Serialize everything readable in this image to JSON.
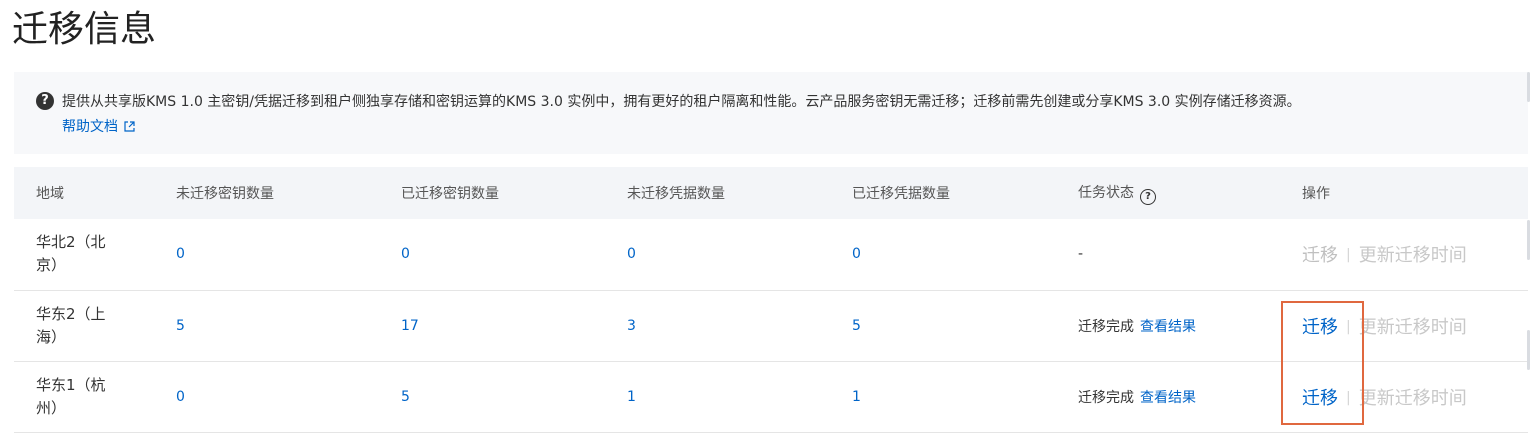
{
  "page": {
    "title": "迁移信息"
  },
  "notice": {
    "message": "提供从共享版KMS 1.0 主密钥/凭据迁移到租户侧独享存储和密钥运算的KMS 3.0 实例中，拥有更好的租户隔离和性能。云产品服务密钥无需迁移；迁移前需先创建或分享KMS 3.0 实例存储迁移资源。",
    "help_link": "帮助文档"
  },
  "table": {
    "headers": [
      "地域",
      "未迁移密钥数量",
      "已迁移密钥数量",
      "未迁移凭据数量",
      "已迁移凭据数量",
      "任务状态",
      "操作"
    ],
    "rows": [
      {
        "region": "华北2（北京）",
        "unmigrated_keys": "0",
        "migrated_keys": "0",
        "unmigrated_secrets": "0",
        "migrated_secrets": "0",
        "status": "-",
        "status_link": "",
        "op_migrate": "迁移",
        "op_update": "更新迁移时间"
      },
      {
        "region": "华东2（上海）",
        "unmigrated_keys": "5",
        "migrated_keys": "17",
        "unmigrated_secrets": "3",
        "migrated_secrets": "5",
        "status": "迁移完成",
        "status_link": "查看结果",
        "op_migrate": "迁移",
        "op_update": "更新迁移时间"
      },
      {
        "region": "华东1（杭州）",
        "unmigrated_keys": "0",
        "migrated_keys": "5",
        "unmigrated_secrets": "1",
        "migrated_secrets": "1",
        "status": "迁移完成",
        "status_link": "查看结果",
        "op_migrate": "迁移",
        "op_update": "更新迁移时间"
      }
    ]
  },
  "colors": {
    "link": "#0064c8",
    "highlight": "#e0683f",
    "header_bg": "#f3f5f8",
    "notice_bg": "#f7f8fa"
  }
}
